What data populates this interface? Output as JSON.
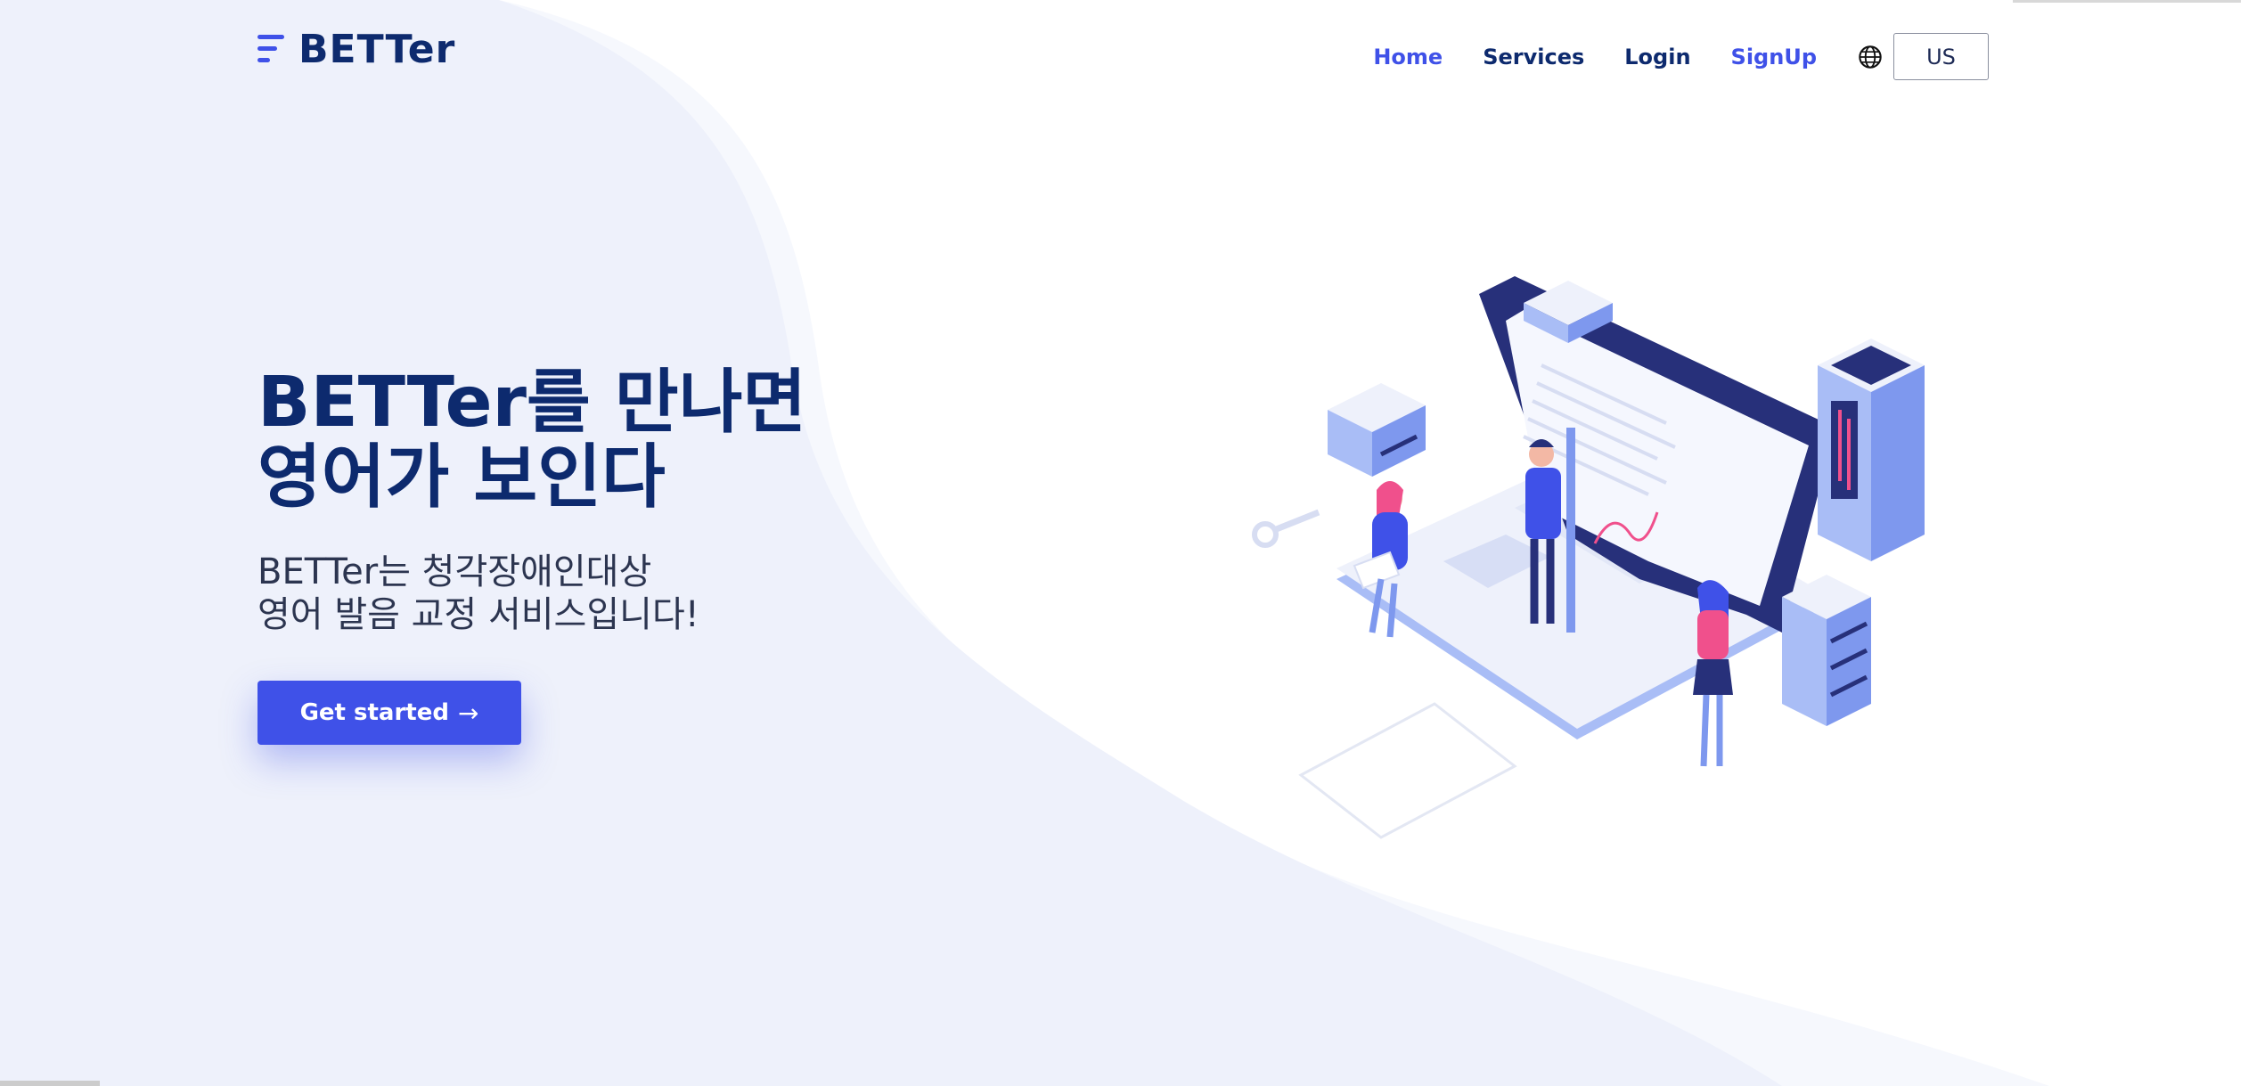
{
  "header": {
    "logo_text": "BETTer",
    "nav": [
      {
        "label": "Home"
      },
      {
        "label": "Services"
      },
      {
        "label": "Login"
      },
      {
        "label": "SignUp"
      }
    ],
    "language": {
      "icon": "globe-icon",
      "selected": "US"
    }
  },
  "hero": {
    "title_line1": "BETTer를 만나면",
    "title_line2": "영어가 보인다",
    "subtitle_line1": "BETTer는 청각장애인대상",
    "subtitle_line2": "영어 발음 교정 서비스입니다!",
    "cta_label": "Get started",
    "cta_icon": "arrow-right-icon"
  },
  "colors": {
    "brand": "#3f51e8",
    "navy": "#0d2a6e",
    "wave": "#eef1fb",
    "accent_pink": "#f0508c"
  }
}
